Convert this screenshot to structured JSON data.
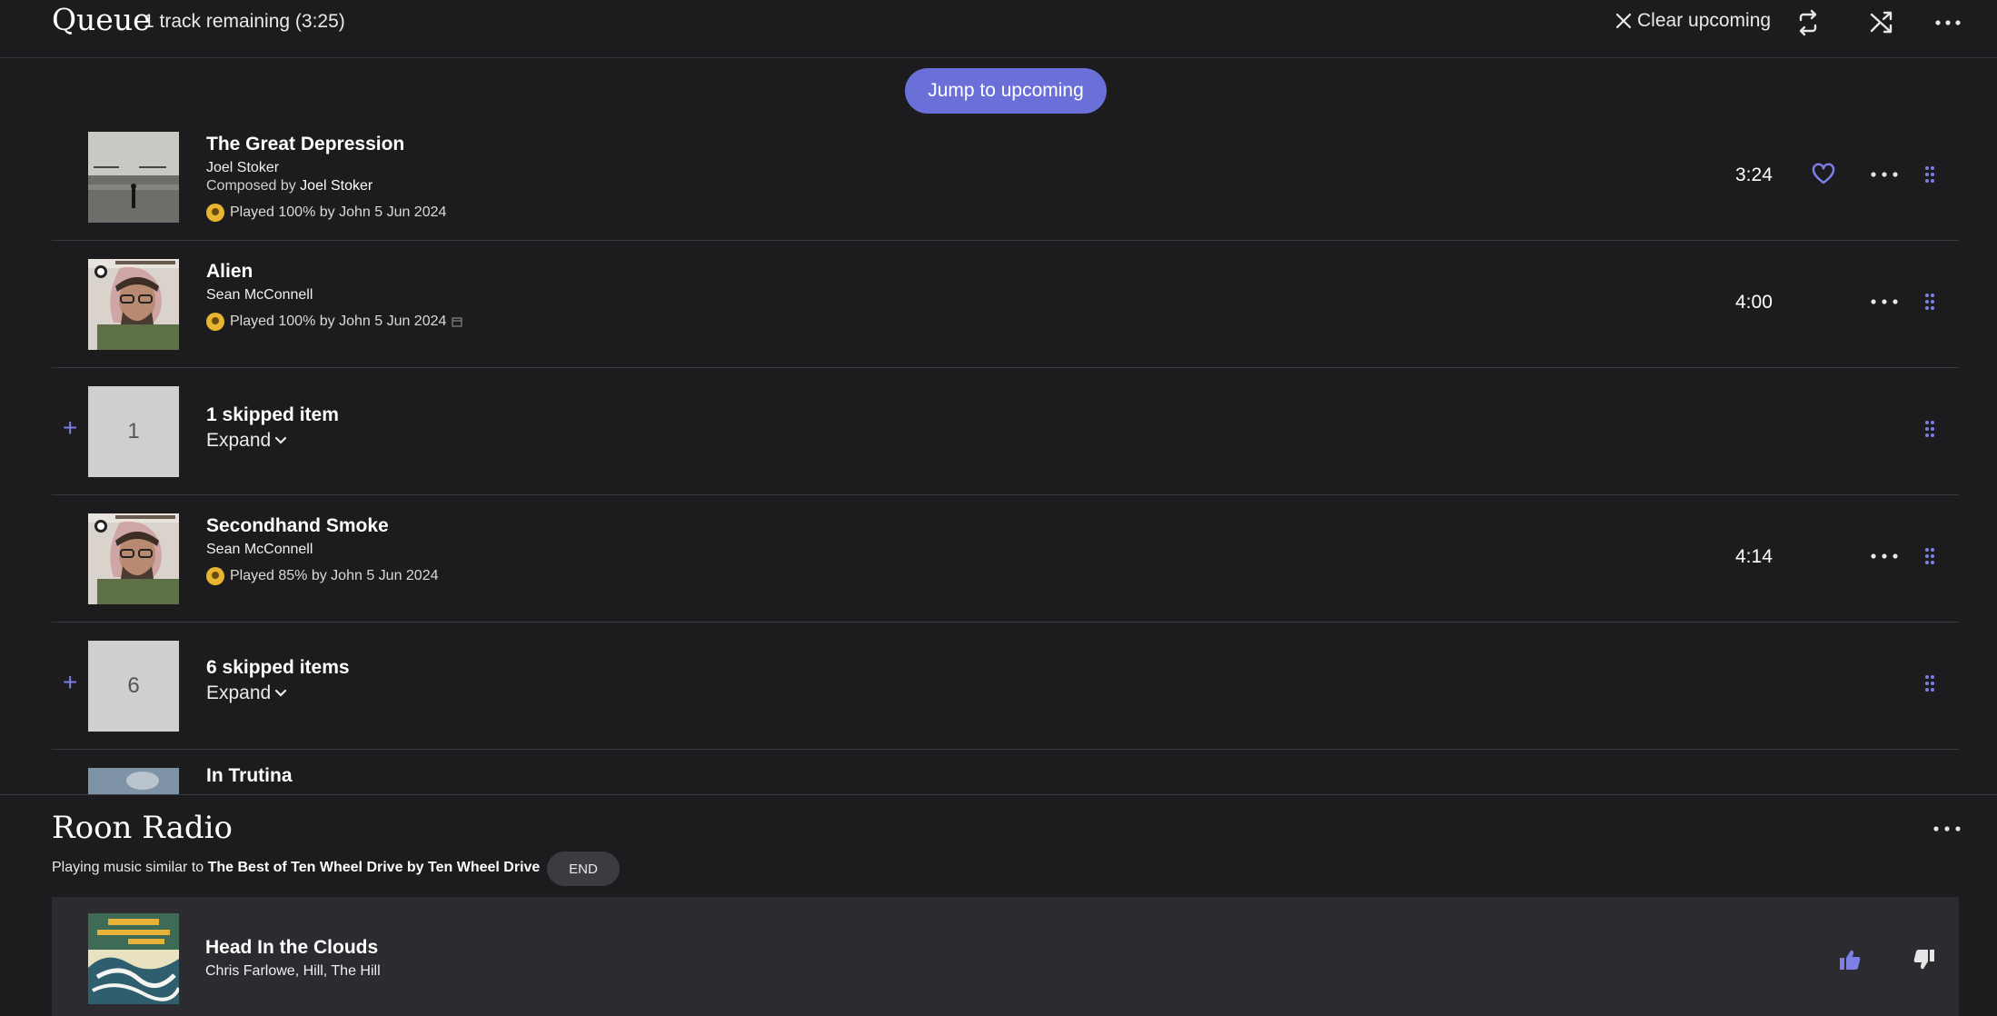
{
  "header": {
    "title": "Queue",
    "subtitle": "1 track remaining (3:25)",
    "clear_label": "Clear upcoming",
    "icons": [
      "close-icon",
      "repeat-icon",
      "shuffle-icon",
      "more-icon"
    ]
  },
  "queue": {
    "jump_label": "Jump to upcoming",
    "items": [
      {
        "title": "The Great Depression",
        "artist": "Joel Stoker",
        "composed_prefix": "Composed by",
        "composer": "Joel Stoker",
        "played": "Played 100% by John 5 Jun 2024",
        "duration": "3:24"
      },
      {
        "title": "Alien",
        "artist": "Sean McConnell",
        "played": "Played 100% by John 5 Jun 2024",
        "duration": "4:00"
      },
      {
        "count": "1",
        "title": "1 skipped item",
        "expand": "Expand"
      },
      {
        "title": "Secondhand Smoke",
        "artist": "Sean McConnell",
        "played": "Played 85% by John 5 Jun 2024",
        "duration": "4:14"
      },
      {
        "count": "6",
        "title": "6 skipped items",
        "expand": "Expand"
      },
      {
        "title": "In Trutina"
      }
    ]
  },
  "radio": {
    "title": "Roon Radio",
    "playing_prefix": "Playing music similar to",
    "source": "The Best of Ten Wheel Drive by Ten Wheel Drive",
    "end_label": "END",
    "track": {
      "title": "Head In the Clouds",
      "artist": "Chris Farlowe, Hill, The Hill"
    }
  },
  "colors": {
    "accent": "#6b6fd8",
    "background": "#1c1c1e",
    "radio_row": "#2b2b30"
  }
}
